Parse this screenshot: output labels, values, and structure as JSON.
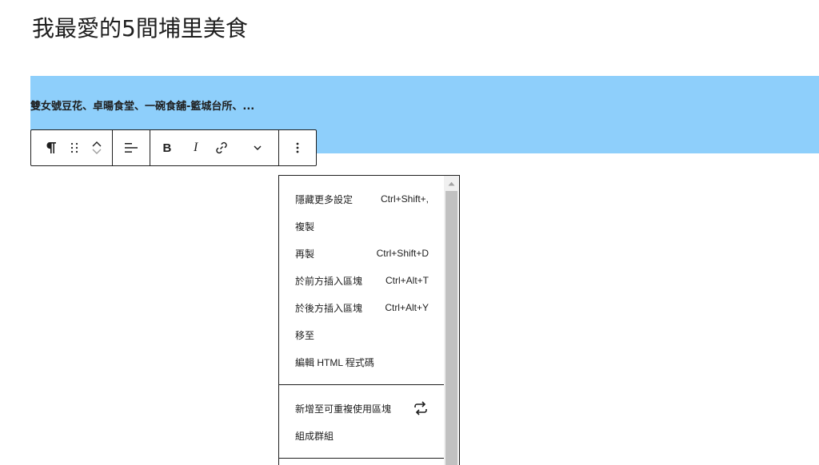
{
  "post": {
    "title": "我最愛的5間埔里美食"
  },
  "paragraph": {
    "text": "雙女號豆花、卓暘食堂、一碗食舖-籃城台所、..."
  },
  "toolbar": {
    "icons": [
      "paragraph-icon",
      "drag-handle-icon",
      "move-up-icon",
      "move-down-icon",
      "align-icon",
      "bold-icon",
      "italic-icon",
      "link-icon",
      "chevron-down-icon",
      "more-options-icon"
    ]
  },
  "menu": {
    "items": [
      {
        "label": "隱藏更多設定",
        "shortcut": "Ctrl+Shift+,"
      },
      {
        "label": "複製",
        "shortcut": ""
      },
      {
        "label": "再製",
        "shortcut": "Ctrl+Shift+D"
      },
      {
        "label": "於前方插入區塊",
        "shortcut": "Ctrl+Alt+T"
      },
      {
        "label": "於後方插入區塊",
        "shortcut": "Ctrl+Alt+Y"
      },
      {
        "label": "移至",
        "shortcut": ""
      },
      {
        "label": "編輯 HTML 程式碼",
        "shortcut": ""
      },
      {
        "label": "新增至可重複使用區塊",
        "icon": "reusable-icon"
      },
      {
        "label": "組成群組",
        "shortcut": ""
      }
    ]
  }
}
